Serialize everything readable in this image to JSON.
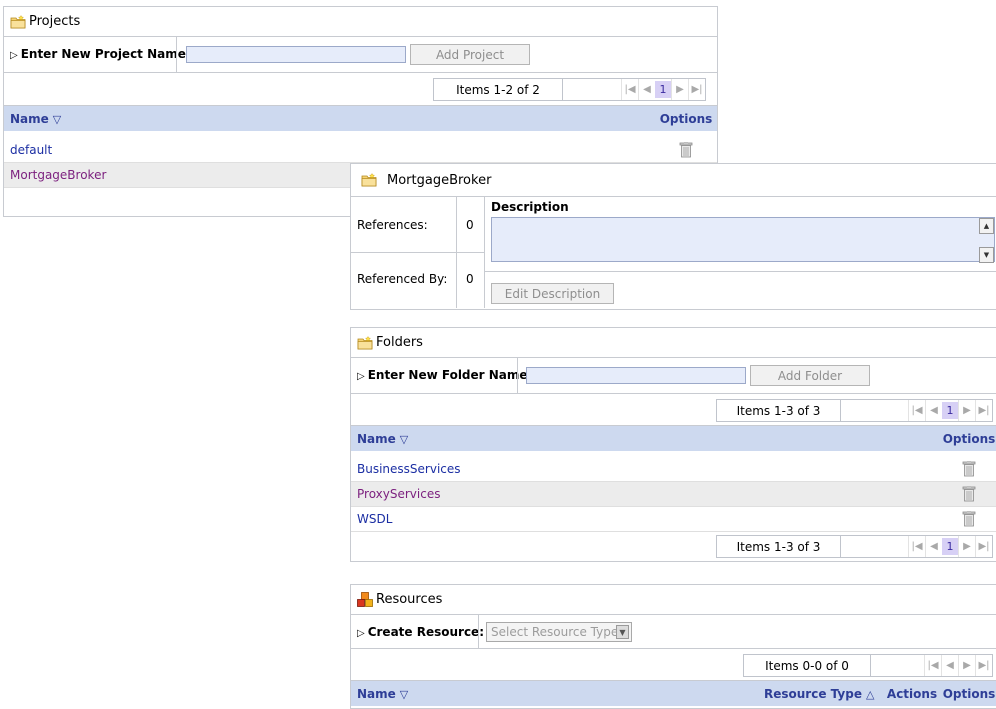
{
  "projects": {
    "title": "Projects",
    "new_label": "Enter New Project Name:",
    "new_value": "",
    "add_button": "Add Project",
    "pager": {
      "items_text": "Items 1-2 of 2",
      "page": "1"
    },
    "columns": {
      "name": "Name",
      "options": "Options"
    },
    "rows": [
      {
        "name": "default"
      },
      {
        "name": "MortgageBroker"
      }
    ]
  },
  "detail": {
    "title": "MortgageBroker",
    "references_label": "References:",
    "references_value": "0",
    "referenced_by_label": "Referenced By:",
    "referenced_by_value": "0",
    "description_label": "Description",
    "description_value": "",
    "edit_button": "Edit Description"
  },
  "folders": {
    "title": "Folders",
    "new_label": "Enter New Folder Name:",
    "new_value": "",
    "add_button": "Add Folder",
    "pager_top": {
      "items_text": "Items 1-3 of 3",
      "page": "1"
    },
    "pager_bottom": {
      "items_text": "Items 1-3 of 3",
      "page": "1"
    },
    "columns": {
      "name": "Name",
      "options": "Options"
    },
    "rows": [
      {
        "name": "BusinessServices"
      },
      {
        "name": "ProxyServices"
      },
      {
        "name": "WSDL"
      }
    ]
  },
  "resources": {
    "title": "Resources",
    "create_label": "Create Resource:",
    "select_placeholder": "Select Resource Type",
    "pager": {
      "items_text": "Items 0-0 of 0"
    },
    "columns": {
      "name": "Name",
      "type": "Resource Type",
      "actions": "Actions",
      "options": "Options"
    }
  }
}
